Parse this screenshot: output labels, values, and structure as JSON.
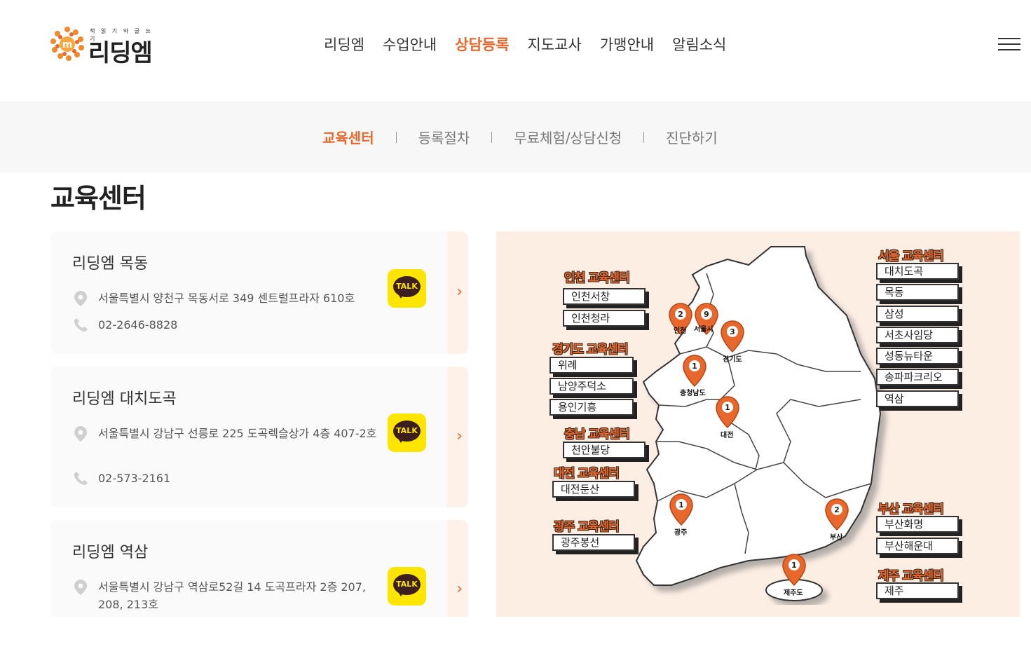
{
  "brand": {
    "tagline": "책 읽 기 와 글 쓰 기",
    "name": "리딩엠",
    "mark": "m",
    "accent_color": "#e8672c"
  },
  "gnb": {
    "items": [
      "리딩엠",
      "수업안내",
      "상담등록",
      "지도교사",
      "가맹안내",
      "알림소식"
    ],
    "active_index": 2
  },
  "subnav": {
    "items": [
      "교육센터",
      "등록절차",
      "무료체험/상담신청",
      "진단하기"
    ],
    "active_index": 0
  },
  "page": {
    "title": "교육센터"
  },
  "cards": [
    {
      "name": "리딩엠 목동",
      "address": "서울특별시 양천구 목동서로 349 센트럴프라자 610호",
      "phone": "02-2646-8828",
      "talk": "TALK"
    },
    {
      "name": "리딩엠 대치도곡",
      "address": "서울특별시 강남구 선릉로 225 도곡렉슬상가 4층 407-2호",
      "phone": "02-573-2161",
      "talk": "TALK"
    },
    {
      "name": "리딩엠 역삼",
      "address": "서울특별시 강남구 역삼로52길 14 도곡프라자 2층 207, 208, 213호",
      "phone": "",
      "talk": "TALK"
    }
  ],
  "map": {
    "regions": [
      {
        "title": "인천 교육센터",
        "centers": [
          "인천서창",
          "인천청라"
        ]
      },
      {
        "title": "경기도 교육센터",
        "centers": [
          "위례",
          "남양주덕소",
          "용인기흥"
        ]
      },
      {
        "title": "충남 교육센터",
        "centers": [
          "천안불당"
        ]
      },
      {
        "title": "대전 교육센터",
        "centers": [
          "대전둔산"
        ]
      },
      {
        "title": "광주 교육센터",
        "centers": [
          "광주봉선"
        ]
      },
      {
        "title": "서울 교육센터",
        "centers": [
          "대치도곡",
          "목동",
          "삼성",
          "서초사임당",
          "성동뉴타운",
          "송파파크리오",
          "역삼"
        ]
      },
      {
        "title": "부산 교육센터",
        "centers": [
          "부산화명",
          "부산해운대"
        ]
      },
      {
        "title": "제주 교육센터",
        "centers": [
          "제주"
        ]
      }
    ],
    "pins": [
      {
        "count": "2",
        "label": "인천"
      },
      {
        "count": "9",
        "label": "서울시"
      },
      {
        "count": "3",
        "label": "경기도"
      },
      {
        "count": "1",
        "label": "충청남도"
      },
      {
        "count": "1",
        "label": "대전"
      },
      {
        "count": "1",
        "label": "광주"
      },
      {
        "count": "2",
        "label": "부산"
      },
      {
        "count": "1",
        "label": "제주도"
      }
    ]
  }
}
